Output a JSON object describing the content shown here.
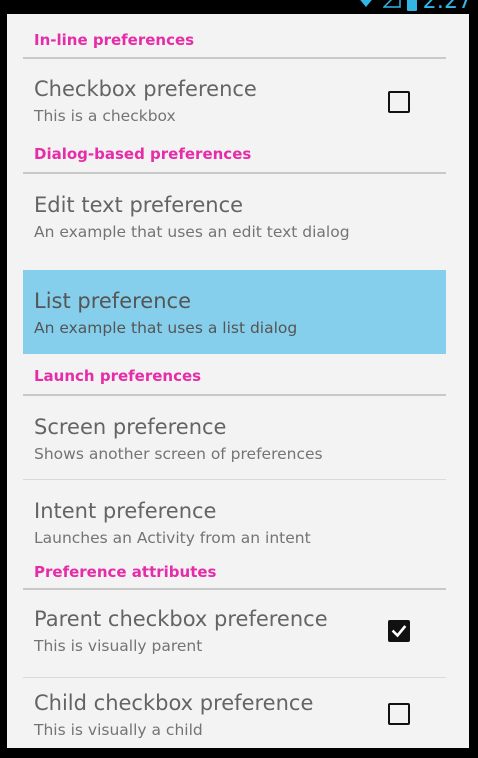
{
  "status_bar": {
    "time": "2:27",
    "wifi_icon": "wifi-icon",
    "signal_icon": "signal-icon",
    "battery_icon": "battery-icon",
    "accent_color": "#33b5e5"
  },
  "theme": {
    "category_color": "#e62ca8",
    "selected_row_color": "#85cfec",
    "background": "#f3f3f3"
  },
  "sections": {
    "inline": {
      "header": "In-line preferences",
      "checkbox_pref": {
        "title": "Checkbox preference",
        "summary": "This is a checkbox",
        "checked": false
      }
    },
    "dialog": {
      "header": "Dialog-based preferences",
      "edit_text_pref": {
        "title": "Edit text preference",
        "summary": "An example that uses an edit text dialog"
      },
      "list_pref": {
        "title": "List preference",
        "summary": "An example that uses a list dialog",
        "selected": true
      }
    },
    "launch": {
      "header": "Launch preferences",
      "screen_pref": {
        "title": "Screen preference",
        "summary": "Shows another screen of preferences"
      },
      "intent_pref": {
        "title": "Intent preference",
        "summary": "Launches an Activity from an intent"
      }
    },
    "attributes": {
      "header": "Preference attributes",
      "parent_pref": {
        "title": "Parent checkbox preference",
        "summary": "This is visually parent",
        "checked": true
      },
      "child_pref": {
        "title": "Child checkbox preference",
        "summary": "This is visually a child",
        "checked": false
      }
    }
  }
}
